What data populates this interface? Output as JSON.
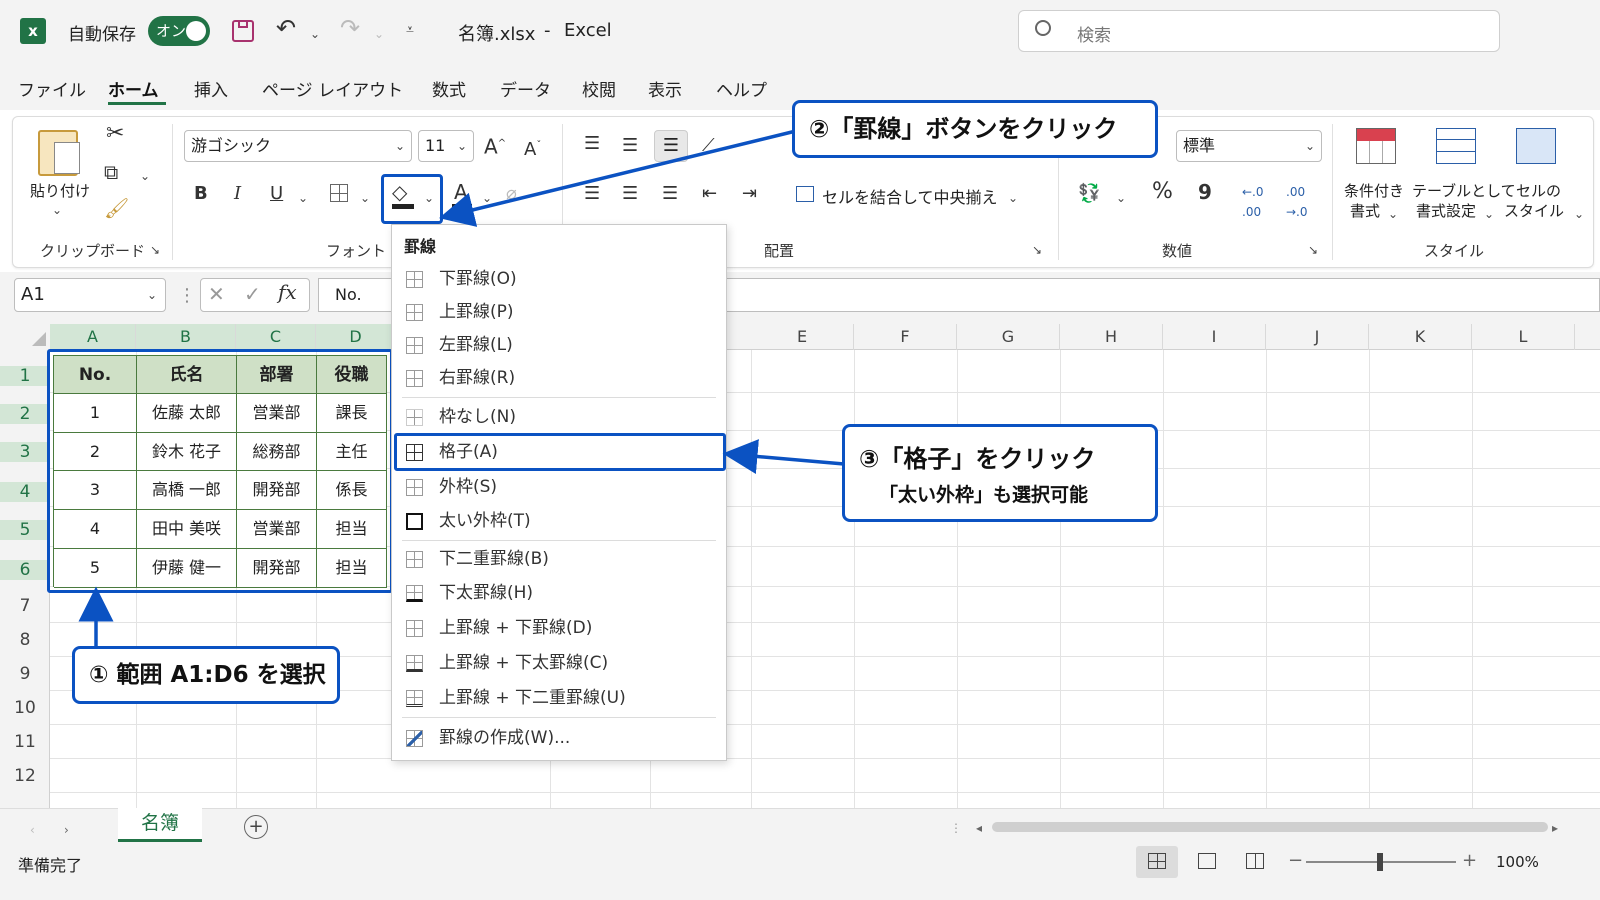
{
  "title_bar": {
    "app_icon": "excel-icon",
    "autosave_label": "自動保存",
    "autosave_toggle": "オン",
    "filename": "名簿.xlsx",
    "separator": "-",
    "app_name": "Excel",
    "search_placeholder": "検索"
  },
  "tabs": [
    "ファイル",
    "ホーム",
    "挿入",
    "ページ レイアウト",
    "数式",
    "データ",
    "校閲",
    "表示",
    "ヘルプ"
  ],
  "active_tab": "ホーム",
  "ribbon": {
    "clipboard": {
      "paste_label": "貼り付け",
      "group_label": "クリップボード"
    },
    "font": {
      "font_name": "游ゴシック",
      "font_size": "11",
      "group_label": "フォント",
      "bold": "B",
      "italic": "I",
      "underline": "U"
    },
    "alignment": {
      "merge_label": "セルを結合して中央揃え",
      "group_label": "配置"
    },
    "number": {
      "format": "標準",
      "percent": "%",
      "comma": "9",
      "group_label": "数値"
    },
    "styles": {
      "conditional_line1": "条件付き",
      "conditional_line2": "書式",
      "table_line1": "テーブルとして",
      "table_line2": "書式設定",
      "cell_line1": "セルの",
      "cell_line2": "スタイル",
      "group_label": "スタイル"
    }
  },
  "formula_bar": {
    "name_box": "A1",
    "fx": "fx",
    "content": "No."
  },
  "columns": [
    "A",
    "B",
    "C",
    "D",
    "E",
    "F",
    "G",
    "H",
    "I",
    "J",
    "K",
    "L"
  ],
  "rows": [
    "1",
    "2",
    "3",
    "4",
    "5",
    "6",
    "7",
    "8",
    "9",
    "10",
    "11",
    "12"
  ],
  "table": {
    "headers": [
      "No.",
      "氏名",
      "部署",
      "役職"
    ],
    "rows": [
      [
        "1",
        "佐藤 太郎",
        "営業部",
        "課長"
      ],
      [
        "2",
        "鈴木 花子",
        "総務部",
        "主任"
      ],
      [
        "3",
        "高橋 一郎",
        "開発部",
        "係長"
      ],
      [
        "4",
        "田中 美咲",
        "営業部",
        "担当"
      ],
      [
        "5",
        "伊藤 健一",
        "開発部",
        "担当"
      ]
    ]
  },
  "border_menu": {
    "title": "罫線",
    "items": [
      "下罫線(O)",
      "上罫線(P)",
      "左罫線(L)",
      "右罫線(R)",
      "枠なし(N)",
      "格子(A)",
      "外枠(S)",
      "太い外枠(T)",
      "下二重罫線(B)",
      "下太罫線(H)",
      "上罫線 + 下罫線(D)",
      "上罫線 + 下太罫線(C)",
      "上罫線 + 下二重罫線(U)",
      "罫線の作成(W)..."
    ]
  },
  "callouts": {
    "step1": "① 範囲 A1:D6 を選択",
    "step2": "②「罫線」ボタンをクリック",
    "step3_main": "③「格子」をクリック",
    "step3_sub": "「太い外枠」も選択可能"
  },
  "sheet_tab": "名簿",
  "status": {
    "ready": "準備完了",
    "zoom": "100%"
  },
  "colors": {
    "accent_blue": "#0b52c2",
    "excel_green": "#217346",
    "header_fill": "#cfe0c6"
  }
}
